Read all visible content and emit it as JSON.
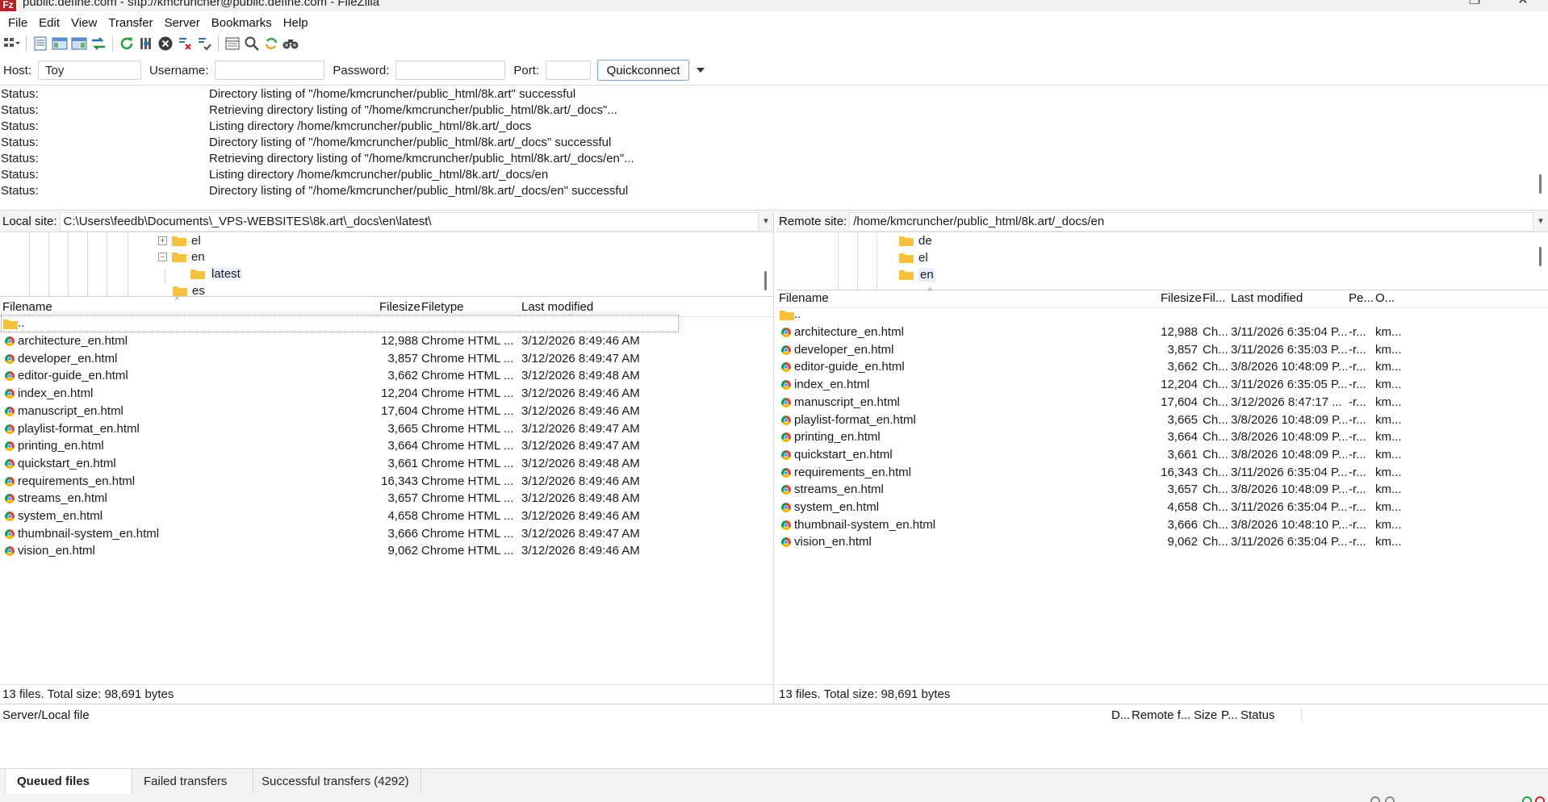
{
  "window": {
    "title": "public.define.com - sftp://kmcruncher@public.define.com - FileZilla",
    "app_icon": "Fz"
  },
  "menu": [
    "File",
    "Edit",
    "View",
    "Transfer",
    "Server",
    "Bookmarks",
    "Help"
  ],
  "toolbar": {
    "icons": [
      "site-manager-icon",
      "toggle-message-log-icon",
      "toggle-local-tree-icon",
      "toggle-remote-tree-icon",
      "toggle-transfer-queue-icon",
      "refresh-icon",
      "process-queue-icon",
      "cancel-operation-icon",
      "disconnect-icon",
      "reconnect-icon",
      "directory-listing-filters-icon",
      "toggle-sync-browsing-icon",
      "directory-comparison-icon",
      "search-remote-files-icon"
    ]
  },
  "quickconnect": {
    "host_label": "Host:",
    "host_value": "Toy",
    "username_label": "Username:",
    "username_value": "",
    "password_label": "Password:",
    "password_value": "",
    "port_label": "Port:",
    "port_value": "",
    "button_label": "Quickconnect"
  },
  "message_log": [
    {
      "label": "Status:",
      "text": "Directory listing of \"/home/kmcruncher/public_html/8k.art\" successful"
    },
    {
      "label": "Status:",
      "text": "Retrieving directory listing of \"/home/kmcruncher/public_html/8k.art/_docs\"..."
    },
    {
      "label": "Status:",
      "text": "Listing directory /home/kmcruncher/public_html/8k.art/_docs"
    },
    {
      "label": "Status:",
      "text": "Directory listing of \"/home/kmcruncher/public_html/8k.art/_docs\" successful"
    },
    {
      "label": "Status:",
      "text": "Retrieving directory listing of \"/home/kmcruncher/public_html/8k.art/_docs/en\"..."
    },
    {
      "label": "Status:",
      "text": "Listing directory /home/kmcruncher/public_html/8k.art/_docs/en"
    },
    {
      "label": "Status:",
      "text": "Directory listing of \"/home/kmcruncher/public_html/8k.art/_docs/en\" successful"
    }
  ],
  "local": {
    "site_label": "Local site:",
    "path": "C:\\Users\\feedb\\Documents\\_VPS-WEBSITES\\8k.art\\_docs\\en\\latest\\",
    "tree": [
      {
        "name": "el",
        "expander": "+"
      },
      {
        "name": "en",
        "expander": "−"
      },
      {
        "name": "latest",
        "expander": ""
      },
      {
        "name": "es",
        "expander": ""
      }
    ],
    "columns": {
      "filename": "Filename",
      "filesize": "Filesize",
      "filetype": "Filetype",
      "modified": "Last modified"
    },
    "updir": "..",
    "files": [
      {
        "name": "architecture_en.html",
        "size": "12,988",
        "type": "Chrome HTML ...",
        "modified": "3/12/2026 8:49:46 AM"
      },
      {
        "name": "developer_en.html",
        "size": "3,857",
        "type": "Chrome HTML ...",
        "modified": "3/12/2026 8:49:47 AM"
      },
      {
        "name": "editor-guide_en.html",
        "size": "3,662",
        "type": "Chrome HTML ...",
        "modified": "3/12/2026 8:49:48 AM"
      },
      {
        "name": "index_en.html",
        "size": "12,204",
        "type": "Chrome HTML ...",
        "modified": "3/12/2026 8:49:46 AM"
      },
      {
        "name": "manuscript_en.html",
        "size": "17,604",
        "type": "Chrome HTML ...",
        "modified": "3/12/2026 8:49:46 AM"
      },
      {
        "name": "playlist-format_en.html",
        "size": "3,665",
        "type": "Chrome HTML ...",
        "modified": "3/12/2026 8:49:47 AM"
      },
      {
        "name": "printing_en.html",
        "size": "3,664",
        "type": "Chrome HTML ...",
        "modified": "3/12/2026 8:49:47 AM"
      },
      {
        "name": "quickstart_en.html",
        "size": "3,661",
        "type": "Chrome HTML ...",
        "modified": "3/12/2026 8:49:48 AM"
      },
      {
        "name": "requirements_en.html",
        "size": "16,343",
        "type": "Chrome HTML ...",
        "modified": "3/12/2026 8:49:46 AM"
      },
      {
        "name": "streams_en.html",
        "size": "3,657",
        "type": "Chrome HTML ...",
        "modified": "3/12/2026 8:49:48 AM"
      },
      {
        "name": "system_en.html",
        "size": "4,658",
        "type": "Chrome HTML ...",
        "modified": "3/12/2026 8:49:46 AM"
      },
      {
        "name": "thumbnail-system_en.html",
        "size": "3,666",
        "type": "Chrome HTML ...",
        "modified": "3/12/2026 8:49:47 AM"
      },
      {
        "name": "vision_en.html",
        "size": "9,062",
        "type": "Chrome HTML ...",
        "modified": "3/12/2026 8:49:46 AM"
      }
    ],
    "status": "13 files. Total size: 98,691 bytes"
  },
  "remote": {
    "site_label": "Remote site:",
    "path": "/home/kmcruncher/public_html/8k.art/_docs/en",
    "tree": [
      {
        "name": "de"
      },
      {
        "name": "el"
      },
      {
        "name": "en"
      }
    ],
    "columns": {
      "filename": "Filename",
      "filesize": "Filesize",
      "filetype": "Fil...",
      "modified": "Last modified",
      "permissions": "Pe...",
      "owner": "O..."
    },
    "updir": "..",
    "files": [
      {
        "name": "architecture_en.html",
        "size": "12,988",
        "type": "Ch...",
        "modified": "3/11/2026 6:35:04 P...",
        "perm": "-r...",
        "owner": "km..."
      },
      {
        "name": "developer_en.html",
        "size": "3,857",
        "type": "Ch...",
        "modified": "3/11/2026 6:35:03 P...",
        "perm": "-r...",
        "owner": "km..."
      },
      {
        "name": "editor-guide_en.html",
        "size": "3,662",
        "type": "Ch...",
        "modified": "3/8/2026 10:48:09 P...",
        "perm": "-r...",
        "owner": "km..."
      },
      {
        "name": "index_en.html",
        "size": "12,204",
        "type": "Ch...",
        "modified": "3/11/2026 6:35:05 P...",
        "perm": "-r...",
        "owner": "km..."
      },
      {
        "name": "manuscript_en.html",
        "size": "17,604",
        "type": "Ch...",
        "modified": "3/12/2026 8:47:17 ...",
        "perm": "-r...",
        "owner": "km..."
      },
      {
        "name": "playlist-format_en.html",
        "size": "3,665",
        "type": "Ch...",
        "modified": "3/8/2026 10:48:09 P...",
        "perm": "-r...",
        "owner": "km..."
      },
      {
        "name": "printing_en.html",
        "size": "3,664",
        "type": "Ch...",
        "modified": "3/8/2026 10:48:09 P...",
        "perm": "-r...",
        "owner": "km..."
      },
      {
        "name": "quickstart_en.html",
        "size": "3,661",
        "type": "Ch...",
        "modified": "3/8/2026 10:48:09 P...",
        "perm": "-r...",
        "owner": "km..."
      },
      {
        "name": "requirements_en.html",
        "size": "16,343",
        "type": "Ch...",
        "modified": "3/11/2026 6:35:04 P...",
        "perm": "-r...",
        "owner": "km..."
      },
      {
        "name": "streams_en.html",
        "size": "3,657",
        "type": "Ch...",
        "modified": "3/8/2026 10:48:09 P...",
        "perm": "-r...",
        "owner": "km..."
      },
      {
        "name": "system_en.html",
        "size": "4,658",
        "type": "Ch...",
        "modified": "3/11/2026 6:35:04 P...",
        "perm": "-r...",
        "owner": "km..."
      },
      {
        "name": "thumbnail-system_en.html",
        "size": "3,666",
        "type": "Ch...",
        "modified": "3/8/2026 10:48:10 P...",
        "perm": "-r...",
        "owner": "km..."
      },
      {
        "name": "vision_en.html",
        "size": "9,062",
        "type": "Ch...",
        "modified": "3/11/2026 6:35:04 P...",
        "perm": "-r...",
        "owner": "km..."
      }
    ],
    "status": "13 files. Total size: 98,691 bytes"
  },
  "queue": {
    "columns": {
      "server_local": "Server/Local file",
      "direction": "D...",
      "remote": "Remote f...",
      "size": "Size",
      "priority": "P...",
      "status": "Status"
    },
    "tabs": [
      {
        "label": "Queued files",
        "active": true
      },
      {
        "label": "Failed transfers",
        "active": false
      },
      {
        "label": "Successful transfers (4292)",
        "active": false
      }
    ]
  },
  "colors": {
    "folder": "#f5c13f",
    "chrome_red": "#db4437",
    "chrome_green": "#0f9d58",
    "chrome_yellow": "#f4b400",
    "chrome_blue": "#4285f4",
    "quickconnect_border": "#7aa7d6"
  }
}
